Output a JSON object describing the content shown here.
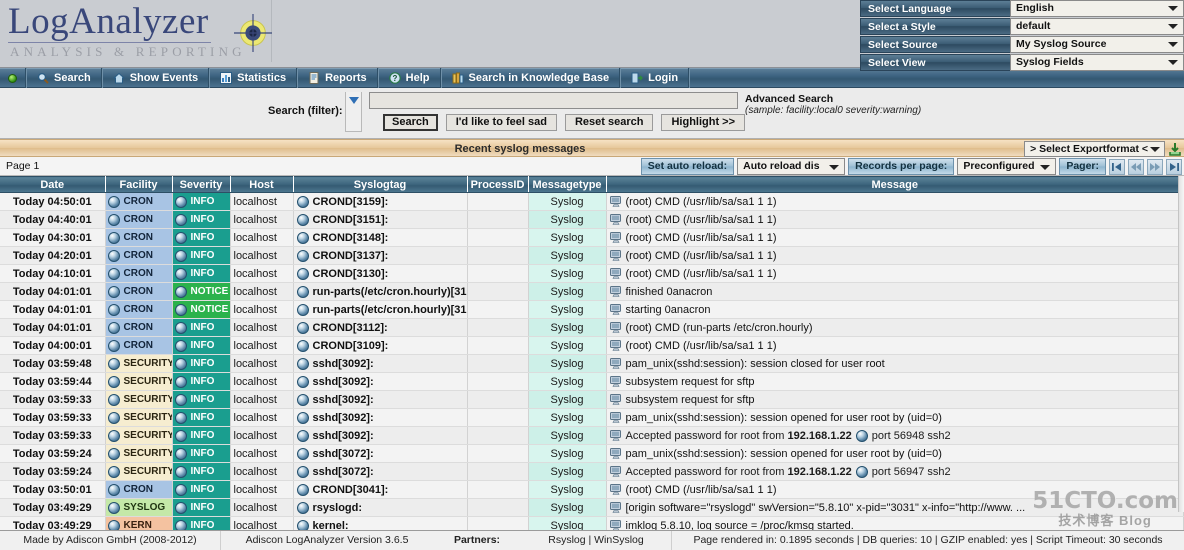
{
  "brand": {
    "name_part1": "Log",
    "name_part2": "Analyzer",
    "tagline": "ANALYSIS & REPORTING"
  },
  "selectors": [
    {
      "label": "Select Language",
      "value": "English"
    },
    {
      "label": "Select a Style",
      "value": "default"
    },
    {
      "label": "Select Source",
      "value": "My Syslog Source"
    },
    {
      "label": "Select View",
      "value": "Syslog Fields"
    }
  ],
  "nav": {
    "items": [
      {
        "label": "Search",
        "icon": "magnifier-icon"
      },
      {
        "label": "Show Events",
        "icon": "house-icon"
      },
      {
        "label": "Statistics",
        "icon": "chart-icon"
      },
      {
        "label": "Reports",
        "icon": "report-icon"
      },
      {
        "label": "Help",
        "icon": "question-icon"
      },
      {
        "label": "Search in Knowledge Base",
        "icon": "books-icon"
      },
      {
        "label": "Login",
        "icon": "login-icon"
      }
    ]
  },
  "search": {
    "label": "Search (filter):",
    "value": "",
    "placeholder": "",
    "advanced_title": "Advanced Search",
    "advanced_sample": "(sample: facility:local0 severity:warning)",
    "buttons": [
      "Search",
      "I'd like to feel sad",
      "Reset search",
      "Highlight >>"
    ]
  },
  "section": {
    "title": "Recent syslog messages",
    "export_label": "> Select Exportformat <"
  },
  "toolbar": {
    "page_label": "Page 1",
    "auto_reload_label": "Set auto reload:",
    "auto_reload_value": "Auto reload dis",
    "records_label": "Records per page:",
    "records_value": "Preconfigured",
    "pager_label": "Pager:",
    "pager_buttons": [
      "first-page",
      "prev-page",
      "next-page",
      "last-page"
    ]
  },
  "table": {
    "columns": [
      "Date",
      "Facility",
      "Severity",
      "Host",
      "Syslogtag",
      "ProcessID",
      "Messagetype",
      "Message"
    ],
    "rows": [
      {
        "date": "Today 04:50:01",
        "facility": "CRON",
        "severity": "INFO",
        "host": "localhost",
        "syslogtag": "CROND[3159]:",
        "processid": "",
        "messagetype": "Syslog",
        "message": "(root) CMD (/usr/lib/sa/sa1 1 1)"
      },
      {
        "date": "Today 04:40:01",
        "facility": "CRON",
        "severity": "INFO",
        "host": "localhost",
        "syslogtag": "CROND[3151]:",
        "processid": "",
        "messagetype": "Syslog",
        "message": "(root) CMD (/usr/lib/sa/sa1 1 1)"
      },
      {
        "date": "Today 04:30:01",
        "facility": "CRON",
        "severity": "INFO",
        "host": "localhost",
        "syslogtag": "CROND[3148]:",
        "processid": "",
        "messagetype": "Syslog",
        "message": "(root) CMD (/usr/lib/sa/sa1 1 1)"
      },
      {
        "date": "Today 04:20:01",
        "facility": "CRON",
        "severity": "INFO",
        "host": "localhost",
        "syslogtag": "CROND[3137]:",
        "processid": "",
        "messagetype": "Syslog",
        "message": "(root) CMD (/usr/lib/sa/sa1 1 1)"
      },
      {
        "date": "Today 04:10:01",
        "facility": "CRON",
        "severity": "INFO",
        "host": "localhost",
        "syslogtag": "CROND[3130]:",
        "processid": "",
        "messagetype": "Syslog",
        "message": "(root) CMD (/usr/lib/sa/sa1 1 1)"
      },
      {
        "date": "Today 04:01:01",
        "facility": "CRON",
        "severity": "NOTICE",
        "host": "localhost",
        "syslogtag": "run-parts(/etc/cron.hourly)[31...",
        "processid": "",
        "messagetype": "Syslog",
        "message": "finished 0anacron"
      },
      {
        "date": "Today 04:01:01",
        "facility": "CRON",
        "severity": "NOTICE",
        "host": "localhost",
        "syslogtag": "run-parts(/etc/cron.hourly)[31...",
        "processid": "",
        "messagetype": "Syslog",
        "message": "starting 0anacron"
      },
      {
        "date": "Today 04:01:01",
        "facility": "CRON",
        "severity": "INFO",
        "host": "localhost",
        "syslogtag": "CROND[3112]:",
        "processid": "",
        "messagetype": "Syslog",
        "message": "(root) CMD (run-parts /etc/cron.hourly)"
      },
      {
        "date": "Today 04:00:01",
        "facility": "CRON",
        "severity": "INFO",
        "host": "localhost",
        "syslogtag": "CROND[3109]:",
        "processid": "",
        "messagetype": "Syslog",
        "message": "(root) CMD (/usr/lib/sa/sa1 1 1)"
      },
      {
        "date": "Today 03:59:48",
        "facility": "SECURITY",
        "severity": "INFO",
        "host": "localhost",
        "syslogtag": "sshd[3092]:",
        "processid": "",
        "messagetype": "Syslog",
        "message": "pam_unix(sshd:session): session closed for user root"
      },
      {
        "date": "Today 03:59:44",
        "facility": "SECURITY",
        "severity": "INFO",
        "host": "localhost",
        "syslogtag": "sshd[3092]:",
        "processid": "",
        "messagetype": "Syslog",
        "message": "subsystem request for sftp"
      },
      {
        "date": "Today 03:59:33",
        "facility": "SECURITY",
        "severity": "INFO",
        "host": "localhost",
        "syslogtag": "sshd[3092]:",
        "processid": "",
        "messagetype": "Syslog",
        "message": "subsystem request for sftp"
      },
      {
        "date": "Today 03:59:33",
        "facility": "SECURITY",
        "severity": "INFO",
        "host": "localhost",
        "syslogtag": "sshd[3092]:",
        "processid": "",
        "messagetype": "Syslog",
        "message": "pam_unix(sshd:session): session opened for user root by (uid=0)"
      },
      {
        "date": "Today 03:59:33",
        "facility": "SECURITY",
        "severity": "INFO",
        "host": "localhost",
        "syslogtag": "sshd[3092]:",
        "processid": "",
        "messagetype": "Syslog",
        "message_prefix": "Accepted password for root from ",
        "message_ip": "192.168.1.22",
        "message_suffix": " port 56948 ssh2",
        "message": "Accepted password for root from 192.168.1.22 port 56948 ssh2"
      },
      {
        "date": "Today 03:59:24",
        "facility": "SECURITY",
        "severity": "INFO",
        "host": "localhost",
        "syslogtag": "sshd[3072]:",
        "processid": "",
        "messagetype": "Syslog",
        "message": "pam_unix(sshd:session): session opened for user root by (uid=0)"
      },
      {
        "date": "Today 03:59:24",
        "facility": "SECURITY",
        "severity": "INFO",
        "host": "localhost",
        "syslogtag": "sshd[3072]:",
        "processid": "",
        "messagetype": "Syslog",
        "message_prefix": "Accepted password for root from ",
        "message_ip": "192.168.1.22",
        "message_suffix": " port 56947 ssh2",
        "message": "Accepted password for root from 192.168.1.22 port 56947 ssh2"
      },
      {
        "date": "Today 03:50:01",
        "facility": "CRON",
        "severity": "INFO",
        "host": "localhost",
        "syslogtag": "CROND[3041]:",
        "processid": "",
        "messagetype": "Syslog",
        "message": "(root) CMD (/usr/lib/sa/sa1 1 1)"
      },
      {
        "date": "Today 03:49:29",
        "facility": "SYSLOG",
        "severity": "INFO",
        "host": "localhost",
        "syslogtag": "rsyslogd:",
        "processid": "",
        "messagetype": "Syslog",
        "message": "[origin software=\"rsyslogd\" swVersion=\"5.8.10\" x-pid=\"3031\" x-info=\"http://www. ..."
      },
      {
        "date": "Today 03:49:29",
        "facility": "KERN",
        "severity": "INFO",
        "host": "localhost",
        "syslogtag": "kernel:",
        "processid": "",
        "messagetype": "Syslog",
        "message": "imklog 5.8.10, log source = /proc/kmsg started."
      }
    ]
  },
  "footer": {
    "made_by": "Made by Adiscon GmbH (2008-2012)",
    "version": "Adiscon LogAnalyzer Version 3.6.5",
    "partners_label": "Partners:",
    "partner_links": "Rsyslog  |  WinSyslog",
    "stats": "Page rendered in: 0.1895 seconds  |  DB queries: 10  |  GZIP enabled: yes  |  Script Timeout: 30 seconds"
  },
  "watermark": {
    "line1": "51CTO.com",
    "line2": "技术博客 Blog"
  },
  "colors": {
    "accent_blue": "#3c6280",
    "header_bg": "#c9ccd1",
    "section_bar": "#e6c79a",
    "severity_info": "#1a9e8f",
    "severity_notice": "#2bb24c",
    "facility_cron": "#a8c4e4",
    "facility_security": "#f6edd0",
    "facility_syslog": "#c4e8a8",
    "facility_kern": "#f4c2a0",
    "messagetype_bg": "#d8f5ee"
  }
}
